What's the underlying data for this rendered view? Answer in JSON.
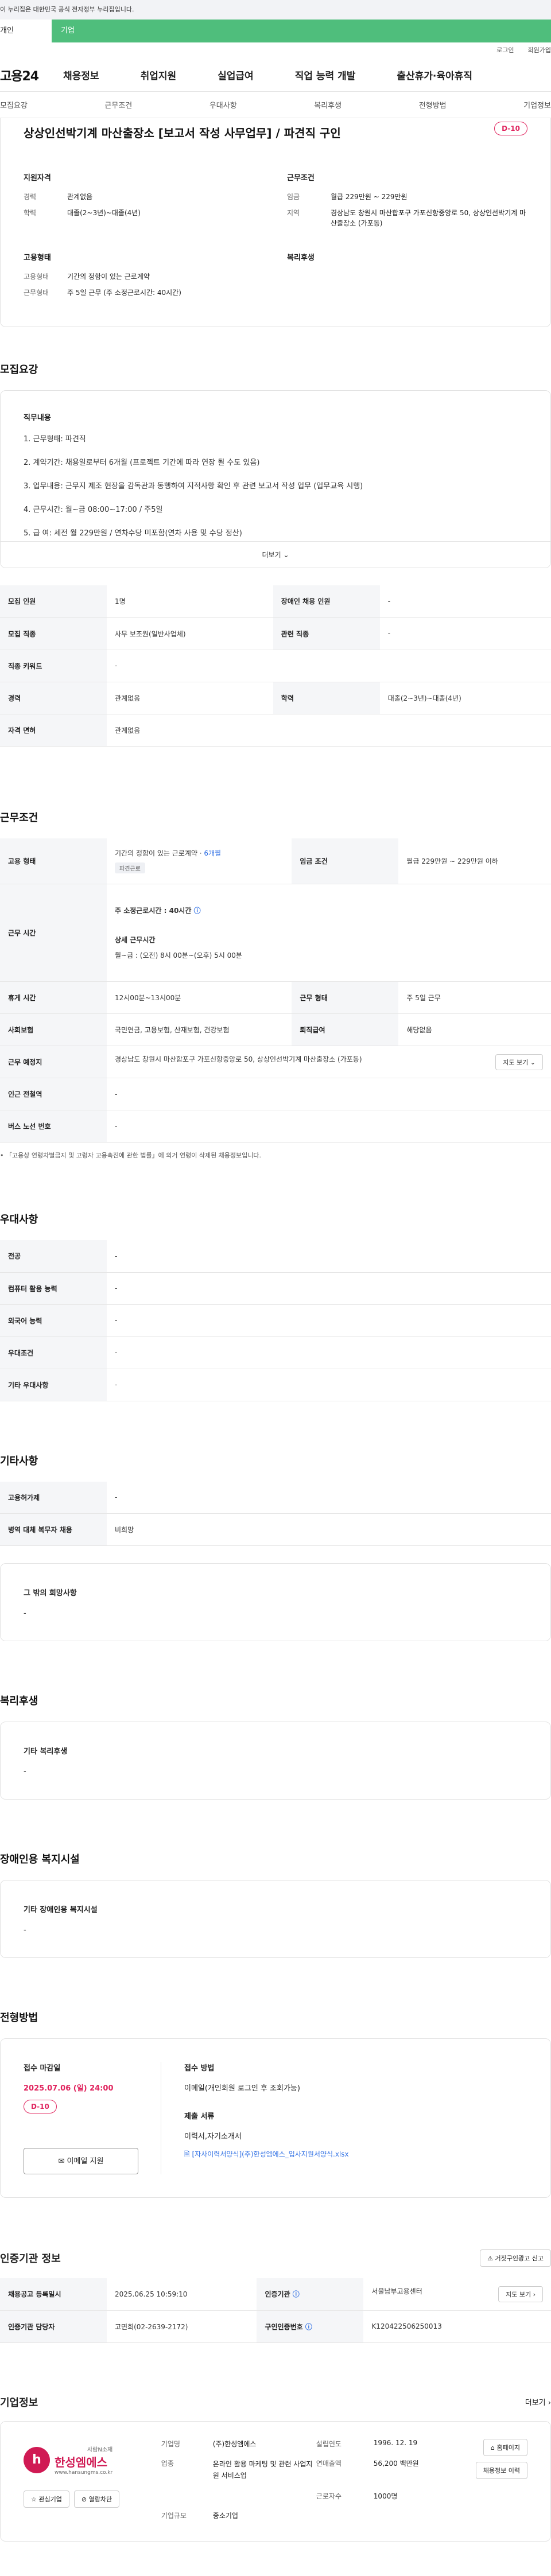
{
  "gov_bar": {
    "text": "이 누리집은 대한민국 공식 전자정부 누리집입니다."
  },
  "top_tabs": {
    "personal": "개인",
    "company": "기업"
  },
  "util": {
    "login": "로그인",
    "join": "회원가입"
  },
  "gnb": {
    "logo": "고용24",
    "items": [
      "채용정보",
      "취업지원",
      "실업급여",
      "직업 능력 개발",
      "출산휴가·육아휴직"
    ]
  },
  "subnav": [
    "모집요강",
    "근무조건",
    "우대사항",
    "복리후생",
    "전형방법",
    "기업정보"
  ],
  "summary": {
    "title": "상상인선박기계 마산출장소 [보고서 작성 사무업무] / 파견직 구인",
    "dday": "D-10",
    "qualification": {
      "heading": "지원자격",
      "rows": [
        {
          "k": "경력",
          "v": "관계없음"
        },
        {
          "k": "학력",
          "v": "대졸(2~3년)~대졸(4년)"
        }
      ]
    },
    "conditions": {
      "heading": "근무조건",
      "rows": [
        {
          "k": "임금",
          "v": "월급 229만원 ~ 229만원"
        },
        {
          "k": "지역",
          "v": "경상남도 창원시 마산합포구 가포신항중앙로 50, 상상인선박기계 마산출장소 (가포동)"
        }
      ]
    },
    "employment": {
      "heading": "고용형태",
      "rows": [
        {
          "k": "고용형태",
          "v": "기간의 정함이 있는 근로계약"
        },
        {
          "k": "근무형태",
          "v": "주 5일 근무 (주 소정근로시간: 40시간)"
        }
      ]
    },
    "welfare": {
      "heading": "복리후생"
    }
  },
  "recruit": {
    "section_title": "모집요강",
    "duty_heading": "직무내용",
    "duties": [
      "1. 근무형태: 파견직",
      "2. 계약기간: 채용일로부터 6개월 (프로젝트 기간에 따라 연장 될 수도 있음)",
      "3. 업무내용: 근무지 제조 현장을 감독관과 동행하여 지적사항 확인 후 관련 보고서 작성 업무 (업무교육 시행)",
      "4. 근무시간: 월~금 08:00~17:00 / 주5일",
      "5. 급      여: 세전 월 229만원 / 연차수당 미포함(연차 사용 및 수당 정산)"
    ],
    "more": "더보기",
    "table": [
      [
        {
          "h": "모집 인원",
          "v": "1명"
        },
        {
          "h": "장애인 채용 인원",
          "v": "-"
        }
      ],
      [
        {
          "h": "모집 직종",
          "v": "사무 보조원(일반사업체)"
        },
        {
          "h": "관련 직종",
          "v": "-"
        }
      ],
      [
        {
          "h": "직종 키워드",
          "v": "-"
        }
      ],
      [
        {
          "h": "경력",
          "v": "관계없음"
        },
        {
          "h": "학력",
          "v": "대졸(2~3년)~대졸(4년)"
        }
      ],
      [
        {
          "h": "자격 면허",
          "v": "관계없음"
        }
      ]
    ]
  },
  "work": {
    "section_title": "근무조건",
    "employment_type_h": "고용 형태",
    "employment_type_v": "기간의 정함이 있는 근로계약 · ",
    "employment_period": "6개월",
    "employment_chip": "파견근로",
    "wage_h": "임금 조건",
    "wage_v": "월급 229만원 ~ 229만원 이하",
    "hours_h": "근무 시간",
    "hours_main": "주 소정근로시간 : 40시간",
    "hours_detail_h": "상세 근무시간",
    "hours_detail_v": "월~금 : (오전) 8시 00분~(오후) 5시 00분",
    "rest_h": "휴게 시간",
    "rest_v": "12시00분~13시00분",
    "type_h": "근무 형태",
    "type_v": "주 5일 근무",
    "insurance_h": "사회보험",
    "insurance_v": "국민연금, 고용보험, 산재보험, 건강보험",
    "severance_h": "퇴직급여",
    "severance_v": "해당없음",
    "location_h": "근무 예정지",
    "location_v": "경상남도 창원시 마산합포구 가포신항중앙로 50, 상상인선박기계 마산출장소 (가포동)",
    "map_btn": "지도 보기",
    "subway_h": "인근 전철역",
    "subway_v": "-",
    "bus_h": "버스 노선 번호",
    "bus_v": "-",
    "note": "「고용상 연령차별금지 및 고령자 고용촉진에 관한 법률」에 의거 연령이 삭제된 채용정보입니다."
  },
  "pref": {
    "section_title": "우대사항",
    "rows": [
      {
        "h": "전공",
        "v": "-"
      },
      {
        "h": "컴퓨터 활용 능력",
        "v": "-"
      },
      {
        "h": "외국어 능력",
        "v": "-"
      },
      {
        "h": "우대조건",
        "v": "-"
      },
      {
        "h": "기타 우대사항",
        "v": "-"
      }
    ]
  },
  "etc": {
    "section_title": "기타사항",
    "rows": [
      {
        "h": "고용허가제",
        "v": "-"
      },
      {
        "h": "병역 대체 복무자 채용",
        "v": "비희망"
      }
    ],
    "wish_h": "그 밖의 희망사항",
    "wish_v": "-"
  },
  "welfare": {
    "section_title": "복리후생",
    "h": "기타 복리후생",
    "v": "-"
  },
  "disability": {
    "section_title": "장애인용 복지시설",
    "h": "기타 장애인용 복지시설",
    "v": "-"
  },
  "apply": {
    "section_title": "전형방법",
    "deadline_h": "접수 마감일",
    "deadline_v": "2025.07.06 (일) 24:00",
    "dday": "D-10",
    "email_btn": "이메일 지원",
    "method_h": "접수 방법",
    "method_v": "이메일(개인회원 로그인 후 조회가능)",
    "docs_h": "제출 서류",
    "docs_v": "이력서,자기소개서",
    "file": "[자사이력서양식](주)한성엠에스_입사지원서양식.xlsx"
  },
  "cert": {
    "section_title": "인증기관 정보",
    "report_btn": "거짓구인광고 신고",
    "rows": [
      [
        {
          "h": "채용공고 등록일시",
          "v": "2025.06.25 10:59:10"
        },
        {
          "h": "인증기관",
          "v": "서울남부고용센터"
        }
      ],
      [
        {
          "h": "인증기관 담당자",
          "v": "고면희(02-2639-2172)"
        },
        {
          "h": "구인인증번호",
          "v": "K120422506250013"
        }
      ]
    ],
    "map_btn": "지도 보기"
  },
  "company": {
    "section_title": "기업정보",
    "more": "더보기",
    "logo_name": "한성엠에스",
    "logo_sub": "사람N소재",
    "logo_url": "www.hansungms.co.kr",
    "fav_btn": "관심기업",
    "block_btn": "열람차단",
    "info": [
      {
        "k": "기업명",
        "v": "(주)한성엠에스"
      },
      {
        "k": "설립연도",
        "v": "1996. 12. 19"
      },
      {
        "k": "업종",
        "v": "온라인 활용 마케팅 및 관련 사업지원 서비스업"
      },
      {
        "k": "연매출액",
        "v": "56,200 백만원"
      },
      {
        "k": "",
        "v": ""
      },
      {
        "k": "근로자수",
        "v": "1000명"
      },
      {
        "k": "기업규모",
        "v": "중소기업"
      }
    ],
    "homepage_btn": "홈페이지",
    "jobs_btn": "채용정보 이력"
  },
  "colors": {
    "brand": "#4fbe7c",
    "dday": "#e0245e",
    "link": "#2f6fe4"
  }
}
